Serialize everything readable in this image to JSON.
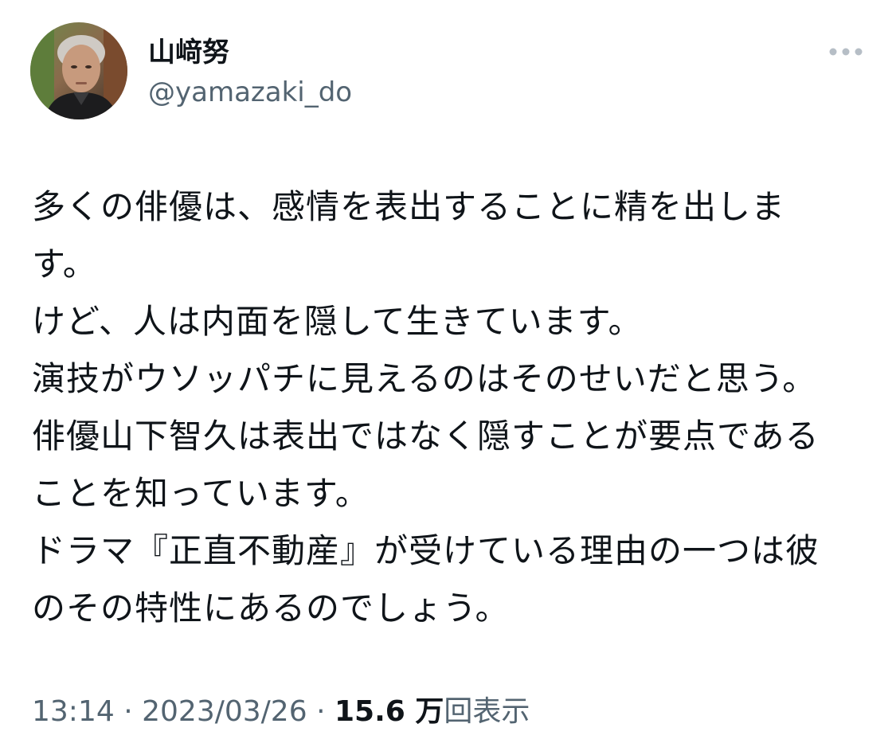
{
  "author": {
    "display_name": "山﨑努",
    "handle": "@yamazaki_do"
  },
  "icons": {
    "more": "more-horizontal-icon"
  },
  "tweet": {
    "lines": [
      "多くの俳優は、感情を表出することに精を出しま",
      "す。",
      "けど、人は内面を隠して生きています。",
      "演技がウソッパチに見えるのはそのせいだと思う。",
      "俳優山下智久は表出ではなく隠すことが要点である",
      "ことを知っています。",
      "ドラマ『正直不動産』が受けている理由の一つは彼",
      "のその特性にあるのでしょう。"
    ]
  },
  "meta": {
    "time": "13:14",
    "separator": "·",
    "date": "2023/03/26",
    "views_count": "15.6 万",
    "views_label": "回表示"
  },
  "colors": {
    "text_primary": "#0f1419",
    "text_secondary": "#536471",
    "icon_gray": "#b6bec6"
  }
}
